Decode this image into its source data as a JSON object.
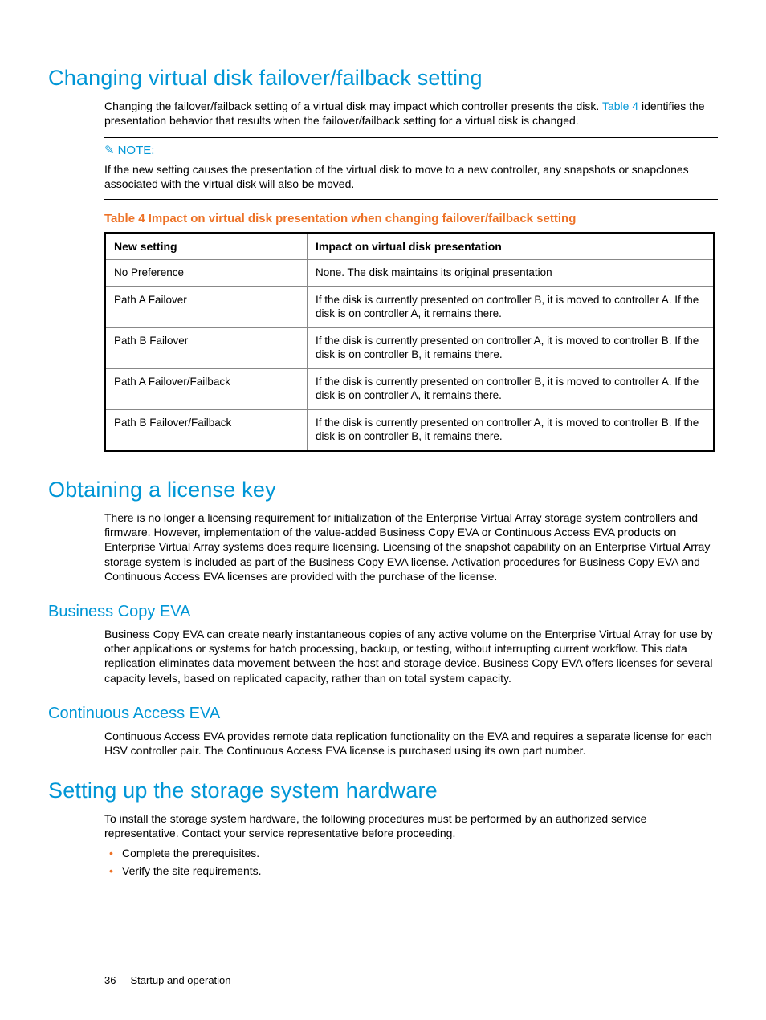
{
  "section1": {
    "heading": "Changing virtual disk failover/failback setting",
    "para_prefix": "Changing the failover/failback setting of a virtual disk may impact which controller presents the disk. ",
    "link_text": "Table 4",
    "para_suffix": " identifies the presentation behavior that results when the failover/failback setting for a virtual disk is changed.",
    "note_label": "NOTE:",
    "note_body": "If the new setting causes the presentation of the virtual disk to move to a new controller, any snapshots or snapclones associated with the virtual disk will also be moved.",
    "table_caption": "Table 4 Impact on virtual disk presentation when changing failover/failback setting",
    "table": {
      "headers": [
        "New setting",
        "Impact on virtual disk presentation"
      ],
      "rows": [
        [
          "No Preference",
          "None. The disk maintains its original presentation"
        ],
        [
          "Path A Failover",
          "If the disk is currently presented on controller B, it is moved to controller A. If the disk is on controller A, it remains there."
        ],
        [
          "Path B Failover",
          "If the disk is currently presented on controller A, it is moved to controller B. If the disk is on controller B, it remains there."
        ],
        [
          "Path A Failover/Failback",
          "If the disk is currently presented on controller B, it is moved to controller A. If the disk is on controller A, it remains there."
        ],
        [
          "Path B Failover/Failback",
          "If the disk is currently presented on controller A, it is moved to controller B. If the disk is on controller B, it remains there."
        ]
      ]
    }
  },
  "section2": {
    "heading": "Obtaining a license key",
    "para": "There is no longer a licensing requirement for initialization of the Enterprise Virtual Array storage system controllers and firmware. However, implementation of the value-added Business Copy EVA or Continuous Access EVA products on Enterprise Virtual Array systems does require licensing. Licensing of the snapshot capability on an Enterprise Virtual Array storage system is included as part of the Business Copy EVA license. Activation procedures for Business Copy EVA and Continuous Access EVA licenses are provided with the purchase of the license.",
    "sub1": {
      "heading": "Business Copy EVA",
      "para": "Business Copy EVA can create nearly instantaneous copies of any active volume on the Enterprise Virtual Array for use by other applications or systems for batch processing, backup, or testing, without interrupting current workflow. This data replication eliminates data movement between the host and storage device. Business Copy EVA offers licenses for several capacity levels, based on replicated capacity, rather than on total system capacity."
    },
    "sub2": {
      "heading": "Continuous Access EVA",
      "para": "Continuous Access EVA provides remote data replication functionality on the EVA and requires a separate license for each HSV controller pair. The Continuous Access EVA license is purchased using its own part number."
    }
  },
  "section3": {
    "heading": "Setting up the storage system hardware",
    "para": "To install the storage system hardware, the following procedures must be performed by an authorized service representative. Contact your service representative before proceeding.",
    "bullets": [
      "Complete the prerequisites.",
      "Verify the site requirements."
    ]
  },
  "footer": {
    "page": "36",
    "title": "Startup and operation"
  }
}
